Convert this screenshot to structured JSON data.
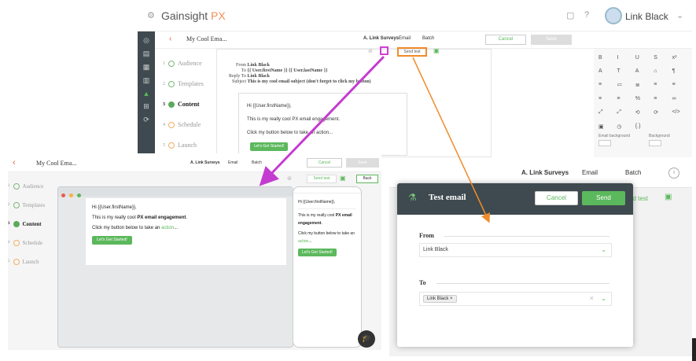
{
  "top": {
    "brand": "Gainsight",
    "brand_px": "PX",
    "user": "Link Black",
    "title": "My Cool Ema...",
    "header_actions": [
      "A. Link Surveys",
      "Email",
      "Batch"
    ],
    "cancel": "Cancel",
    "save": "Save",
    "steps": [
      "Audience",
      "Templates",
      "Content",
      "Schedule",
      "Launch"
    ],
    "send_test": "Send test",
    "email_header": {
      "from_label": "From",
      "from_value": "Link Black",
      "to_label": "To",
      "to_value": "{{ User.firstName }} {{ User.lastName }}",
      "reply_label": "Reply To",
      "reply_value": "Link Black",
      "subject_label": "Subject",
      "subject_value": "This is my cool email subject (don't forget to click my button)"
    },
    "body_greeting": "Hi {{User.firstName}},",
    "body_line1": "This is my really cool PX email engagement.",
    "body_line2": "Click my button below to take an action...",
    "body_button": "Let's Get Started!",
    "tools": [
      "B",
      "I",
      "U",
      "S",
      "x²",
      "A",
      "T",
      "A",
      "⌂",
      "¶",
      "≡",
      "≔",
      "≣",
      "≡",
      "≡",
      "≡",
      "≡",
      "%",
      "≡",
      "∞",
      "⤢",
      "⤢",
      "⟲",
      "⟳",
      "</>",
      "▣",
      "◷",
      "{.}"
    ],
    "email_background": "Email background",
    "background": "Background"
  },
  "left": {
    "title": "My Cool Ema...",
    "header_actions": [
      "A. Link Surveys",
      "Email",
      "Batch"
    ],
    "cancel": "Cancel",
    "save": "Save",
    "send_test": "Send test",
    "back": "Back",
    "steps": [
      "Audience",
      "Templates",
      "Content",
      "Schedule",
      "Launch"
    ],
    "greeting": "Hi {{User.firstName}},",
    "line1_prefix": "This is my really cool",
    "line1_bold": "PX email engagement",
    "line2_prefix": "Click my button below to take an",
    "line2_link": "action",
    "button": "Let's Get Started!",
    "mobile_greeting": "Hi {{User.firstName}},",
    "mobile_line1_prefix": "This is my really cool",
    "mobile_line1_bold": "PX email engagement",
    "mobile_line2_prefix": "Click my button below to take an",
    "mobile_line2_link": "action",
    "mobile_button": "Let's Get Started!"
  },
  "right": {
    "header_actions": [
      "A. Link Surveys",
      "Email",
      "Batch"
    ],
    "send_test_partial": "nd test",
    "modal_title": "Test email",
    "cancel": "Cancel",
    "send": "Send",
    "from_label": "From",
    "from_value": "Link Black",
    "to_label": "To",
    "to_chip": "Link Black"
  },
  "colors": {
    "green": "#5cb85c",
    "orange": "#f08c2a",
    "magenta": "#d23fd2",
    "dark": "#3e4a4f"
  }
}
